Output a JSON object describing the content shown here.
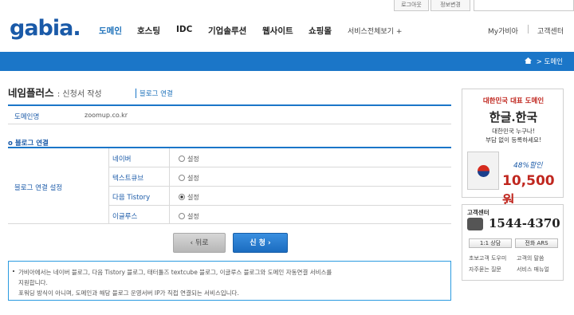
{
  "topbar": {
    "login": "로그아웃",
    "mypage": "정보변경"
  },
  "header": {
    "logo": "gabia.",
    "nav": [
      "도메인",
      "호스팅",
      "IDC",
      "기업솔루션",
      "웹사이트",
      "쇼핑몰"
    ],
    "all_services": "서비스전체보기 +",
    "my_gabia": "My가비아",
    "support": "고객센터"
  },
  "breadcrumb": "도메인",
  "page": {
    "title": "네임플러스",
    "subtitle": ": 신청서 작성",
    "tab": "블로그 연결"
  },
  "domain_row": {
    "label": "도메인명",
    "value": "zoomup.co.kr"
  },
  "section_title": "블로그 연결",
  "blog_setting_label": "블로그 연결 설정",
  "blogs": [
    {
      "name": "네이버",
      "option": "설정",
      "selected": false
    },
    {
      "name": "텍스트큐브",
      "option": "설정",
      "selected": false
    },
    {
      "name": "다음 Tistory",
      "option": "설정",
      "selected": true
    },
    {
      "name": "이글루스",
      "option": "설정",
      "selected": false
    }
  ],
  "buttons": {
    "back": "‹  뒤로",
    "apply": "신 청  ›"
  },
  "notice": {
    "line1": "가비아에서는 네이버 블로그, 다음 Tistory 블로그, 태터툴즈 textcube 블로그, 이글루스 블로그와 도메인 자동연결 서비스를",
    "line2": "지원합니다.",
    "line3": "포워딩 방식이 아니며, 도메인과 해당 블로그 운영서버 IP가 직접 연결되는 서비스입니다."
  },
  "ad": {
    "line1": "대한민국 대표 도메인",
    "line2": "한글.한국",
    "line3": "대한민국 누구나!",
    "line4": "부담 없이 등록하세요!",
    "discount": "48%할인",
    "price": "10,500원"
  },
  "support_box": {
    "title": "고객센터",
    "phone": "1544-4370",
    "btn1": "1:1 상담",
    "btn2": "전화 ARS",
    "links": [
      "초보고객 도우미",
      "고객의 말씀",
      "자주묻는 질문",
      "서비스 매뉴얼"
    ]
  }
}
